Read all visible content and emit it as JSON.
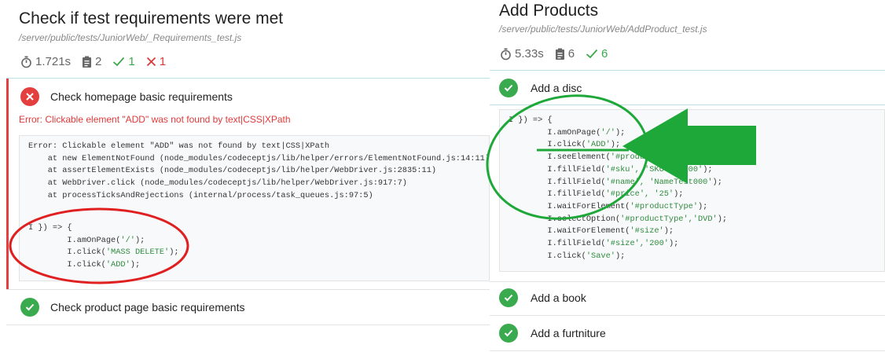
{
  "left": {
    "title": "Check if test requirements were met",
    "path": "/server/public/tests/JuniorWeb/_Requirements_test.js",
    "stats": {
      "duration": "1.721s",
      "total": "2",
      "passed": "1",
      "failed": "1"
    },
    "tests": [
      {
        "label": "Check homepage basic requirements",
        "status": "failed",
        "error": "Error: Clickable element \"ADD\" was not found by text|CSS|XPath",
        "stack": [
          "Error: Clickable element \"ADD\" was not found by text|CSS|XPath",
          "    at new ElementNotFound (node_modules/codeceptjs/lib/helper/errors/ElementNotFound.js:14:11)",
          "    at assertElementExists (node_modules/codeceptjs/lib/helper/WebDriver.js:2835:11)",
          "    at WebDriver.click (node_modules/codeceptjs/lib/helper/WebDriver.js:917:7)",
          "    at processTicksAndRejections (internal/process/task_queues.js:97:5)"
        ],
        "code": {
          "head": "I }) => {",
          "l1_pre": "        I.amOnPage(",
          "l1_str": "'/'",
          "l1_post": ");",
          "l2_pre": "        I.click(",
          "l2_str": "'MASS DELETE'",
          "l2_post": ");",
          "l3_pre": "        I.click(",
          "l3_str": "'ADD'",
          "l3_post": ");"
        }
      },
      {
        "label": "Check product page basic requirements",
        "status": "passed"
      }
    ]
  },
  "right": {
    "title": "Add Products",
    "path": "/server/public/tests/JuniorWeb/AddProduct_test.js",
    "stats": {
      "duration": "5.33s",
      "total": "6",
      "passed": "6"
    },
    "tests": [
      {
        "label": "Add a disc",
        "status": "passed"
      },
      {
        "label": "Add a book",
        "status": "passed"
      },
      {
        "label": "Add a furtniture",
        "status": "passed"
      }
    ],
    "code": [
      [
        "I }) => {",
        "",
        ""
      ],
      [
        "        I.amOnPage(",
        "'/'",
        ");"
      ],
      [
        "        I.click(",
        "'ADD'",
        ");"
      ],
      [
        "        I.seeElement(",
        "'#product_form'",
        ");"
      ],
      [
        "        I.fillField(",
        "'#sku', 'SKUTest000'",
        ");"
      ],
      [
        "        I.fillField(",
        "'#name', 'NameTest000'",
        ");"
      ],
      [
        "        I.fillField(",
        "'#price', '25'",
        ");"
      ],
      [
        "        I.waitForElement(",
        "'#productType'",
        ");"
      ],
      [
        "        I.selectOption(",
        "'#productType','DVD'",
        ");"
      ],
      [
        "        I.waitForElement(",
        "'#size'",
        ");"
      ],
      [
        "        I.fillField(",
        "'#size','200'",
        ");"
      ],
      [
        "        I.click(",
        "'Save'",
        ");"
      ]
    ]
  },
  "colors": {
    "pass": "#3aa84a",
    "fail": "#d93a3a",
    "annotation_red": "#e02020",
    "annotation_green": "#1fa83a"
  }
}
